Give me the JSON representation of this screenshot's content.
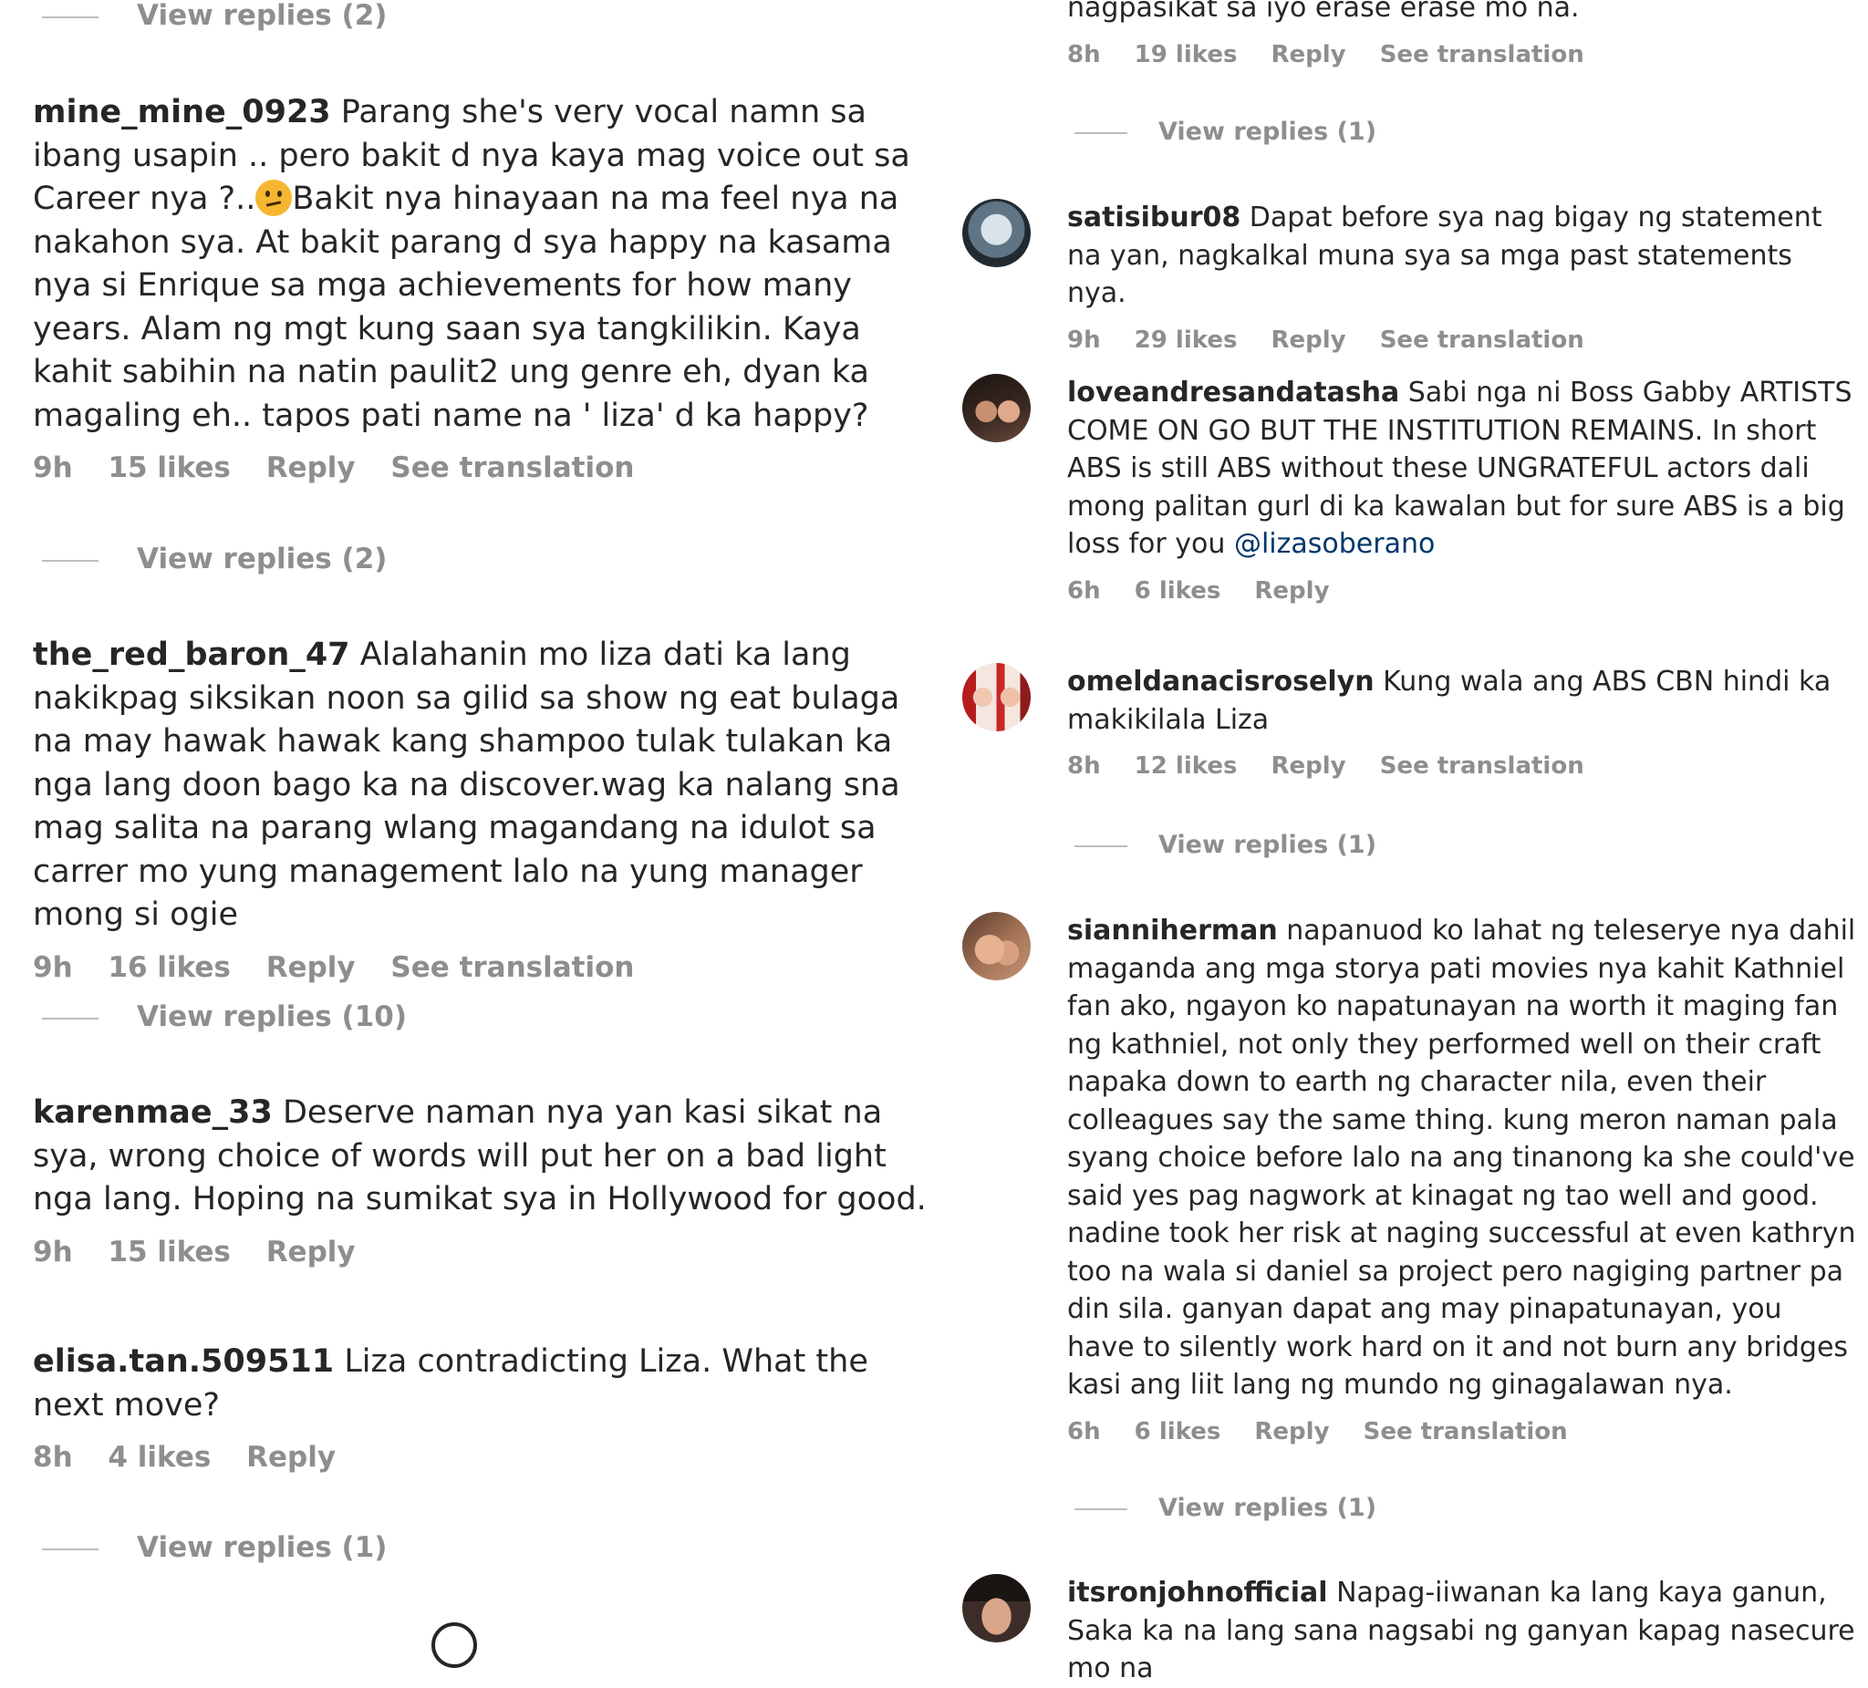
{
  "left_column": {
    "top_view_replies": "View replies (2)",
    "comments": [
      {
        "username": "mine_mine_0923",
        "text_before_emoji": "Parang she's very vocal namn sa ibang usapin .. pero bakit d nya kaya mag voice out sa Career nya ?..",
        "emoji": "confused-face-emoji",
        "text_after_emoji": "Bakit nya hinayaan na ma feel nya na nakahon sya. At bakit parang d sya happy na kasama nya si Enrique sa mga achievements for how many years. Alam ng mgt kung saan sya tangkilikin. Kaya kahit sabihin na natin paulit2 ung genre eh, dyan ka magaling eh.. tapos pati name na ' liza' d ka happy?",
        "time": "9h",
        "likes": "15 likes",
        "reply": "Reply",
        "translation": "See translation",
        "view_replies": "View replies (2)"
      },
      {
        "username": "the_red_baron_47",
        "text": "Alalahanin mo liza dati ka lang nakikpag siksikan noon sa gilid sa show ng eat bulaga na may hawak hawak kang shampoo tulak tulakan ka nga lang doon bago ka na discover.wag ka nalang sna mag salita na parang wlang magandang na idulot sa carrer mo yung management lalo na yung manager mong si ogie",
        "time": "9h",
        "likes": "16 likes",
        "reply": "Reply",
        "translation": "See translation",
        "view_replies": "View replies (10)"
      },
      {
        "username": "karenmae_33",
        "text": "Deserve naman nya yan kasi sikat na sya, wrong choice of words will put her on a bad light nga lang. Hoping na sumikat sya in Hollywood for good.",
        "time": "9h",
        "likes": "15 likes",
        "reply": "Reply"
      },
      {
        "username": "elisa.tan.509511",
        "text": "Liza contradicting Liza. What the next move?",
        "time": "8h",
        "likes": "4 likes",
        "reply": "Reply",
        "view_replies": "View replies (1)"
      }
    ]
  },
  "right_column": {
    "top_partial_text": "nagpasikat sa iyo erase erase mo na.",
    "top_meta": {
      "time": "8h",
      "likes": "19 likes",
      "reply": "Reply",
      "translation": "See translation"
    },
    "top_view_replies": "View replies (1)",
    "comments": [
      {
        "username": "satisibur08",
        "text": "Dapat before sya nag bigay ng statement na yan, nagkalkal muna sya sa mga past statements nya.",
        "time": "9h",
        "likes": "29 likes",
        "reply": "Reply",
        "translation": "See translation"
      },
      {
        "username": "loveandresandatasha",
        "text": "Sabi nga ni Boss Gabby ARTISTS COME ON GO BUT THE INSTITUTION REMAINS. In short ABS is still ABS without these UNGRATEFUL actors dali mong palitan gurl di ka kawalan but for sure ABS is a big loss for you",
        "mention": "@lizasoberano",
        "time": "6h",
        "likes": "6 likes",
        "reply": "Reply"
      },
      {
        "username": "omeldanacisroselyn",
        "text": "Kung wala ang ABS CBN hindi ka makikilala Liza",
        "time": "8h",
        "likes": "12 likes",
        "reply": "Reply",
        "translation": "See translation",
        "view_replies": "View replies (1)"
      },
      {
        "username": "sianniherman",
        "text": "napanuod ko lahat ng teleserye nya dahil maganda ang mga storya pati movies nya kahit Kathniel fan ako, ngayon ko napatunayan na worth it maging fan ng kathniel, not only they performed well on their craft napaka down to earth ng character nila, even their colleagues say the same thing. kung meron naman pala syang choice before lalo na ang tinanong ka she could've said yes pag nagwork at kinagat ng tao well and good. nadine took her risk at naging successful at even kathryn too na wala si daniel sa project pero nagiging partner pa din sila. ganyan dapat ang may pinapatunayan, you have to silently work hard on it and not burn any bridges kasi ang liit lang ng mundo ng ginagalawan nya.",
        "time": "6h",
        "likes": "6 likes",
        "reply": "Reply",
        "translation": "See translation",
        "view_replies": "View replies (1)"
      },
      {
        "username": "itsronjohnofficial",
        "text": "Napag-iiwanan ka lang kaya ganun, Saka ka na lang sana nagsabi ng ganyan kapag nasecure mo na"
      }
    ]
  }
}
